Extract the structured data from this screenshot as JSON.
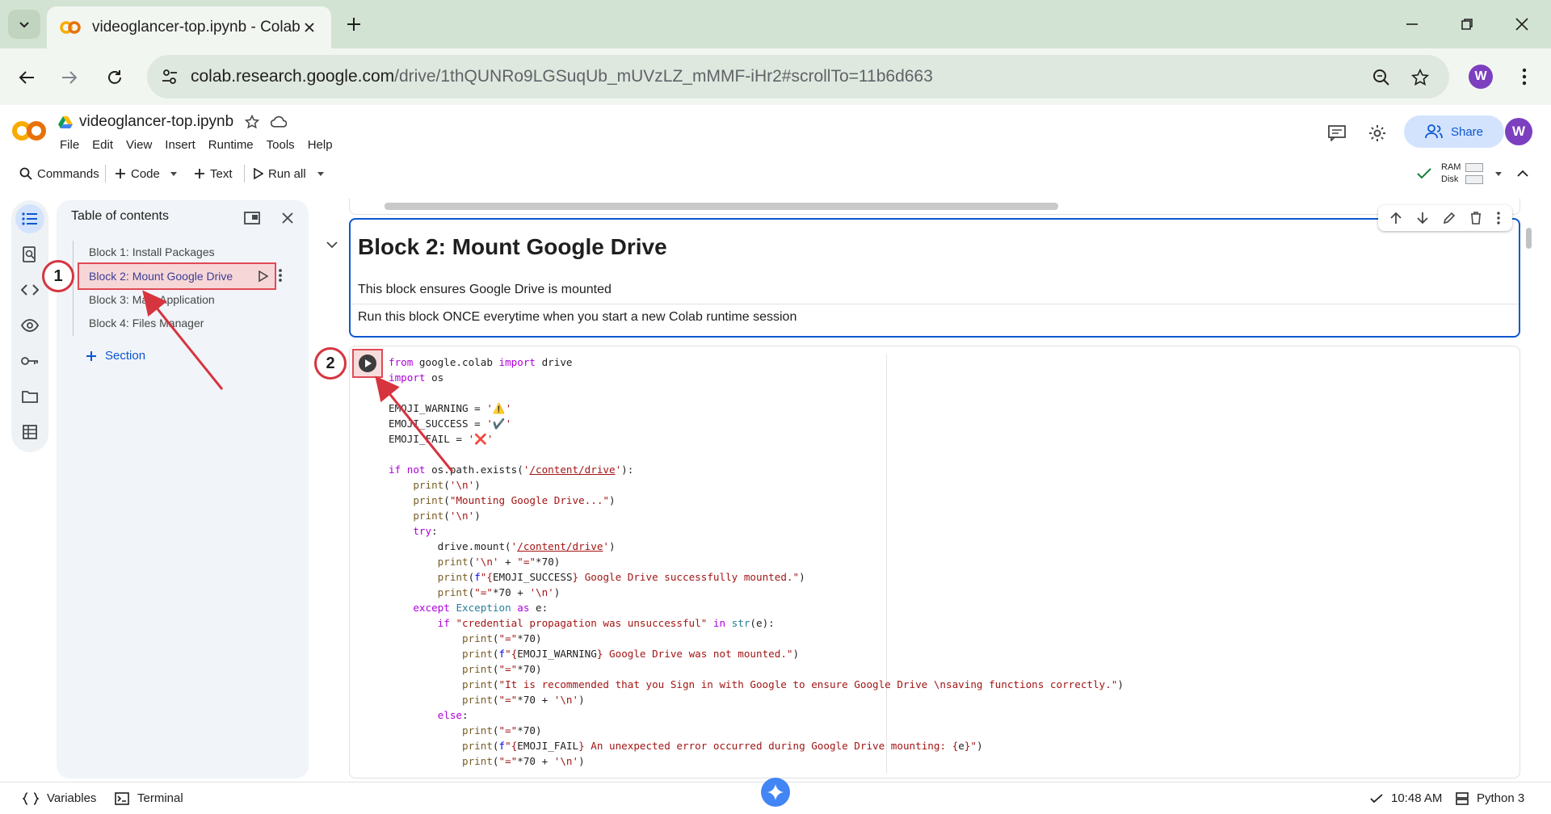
{
  "browser": {
    "tab_title": "videoglancer-top.ipynb - Colab",
    "url_host": "colab.research.google.com",
    "url_path": "/drive/1thQUNRo9LGSuqUb_mUVzLZ_mMMF-iHr2#scrollTo=11b6d663",
    "profile_initial": "W"
  },
  "colab": {
    "notebook_title": "videoglancer-top.ipynb",
    "menus": [
      "File",
      "Edit",
      "View",
      "Insert",
      "Runtime",
      "Tools",
      "Help"
    ],
    "share_label": "Share",
    "profile_initial": "W",
    "commands_label": "Commands",
    "code_label": "Code",
    "text_label": "Text",
    "run_all_label": "Run all",
    "ram_label": "RAM",
    "disk_label": "Disk"
  },
  "toc": {
    "title": "Table of contents",
    "items": [
      "Block 1: Install Packages",
      "Block 2: Mount Google Drive",
      "Block 3: Main Application",
      "Block 4: Files Manager"
    ],
    "add_section_label": "Section"
  },
  "markdown_cell": {
    "heading": "Block 2: Mount Google Drive",
    "para1": "This block ensures Google Drive is mounted",
    "para2": "Run this block ONCE everytime when you start a new Colab runtime session"
  },
  "annotations": {
    "badge1": "1",
    "badge2": "2"
  },
  "status": {
    "variables_label": "Variables",
    "terminal_label": "Terminal",
    "time": "10:48 AM",
    "runtime": "Python 3"
  },
  "colors": {
    "accent": "#0b57d0",
    "annotation_red": "#d6343f",
    "tab_strip": "#d3e3d3"
  }
}
